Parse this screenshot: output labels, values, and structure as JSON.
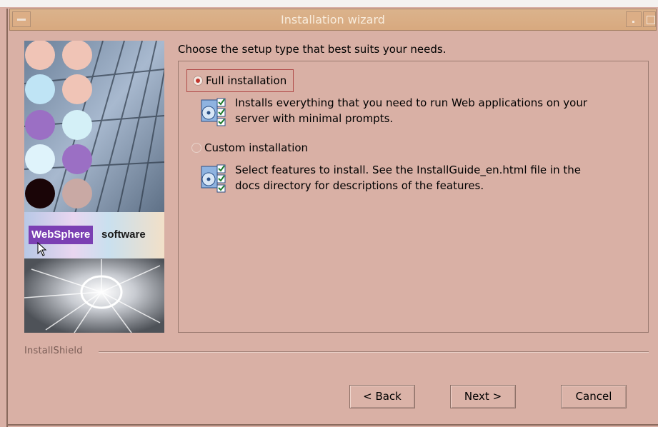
{
  "window": {
    "title": "Installation wizard"
  },
  "banner": {
    "brand": "WebSphere",
    "brand_suffix": "software"
  },
  "prompt": "Choose the setup type that best suits your needs.",
  "options": [
    {
      "label": "Full installation",
      "selected": true,
      "description_line1": "Installs everything that you need to run Web applications on your",
      "description_line2": "server with minimal prompts."
    },
    {
      "label": "Custom installation",
      "selected": false,
      "description_line1": "Select features to install. See the InstallGuide_en.html file in the",
      "description_line2": "docs directory for descriptions of the features."
    }
  ],
  "footer": {
    "brand": "InstallShield"
  },
  "buttons": {
    "back": "< Back",
    "next": "Next >",
    "cancel": "Cancel"
  }
}
